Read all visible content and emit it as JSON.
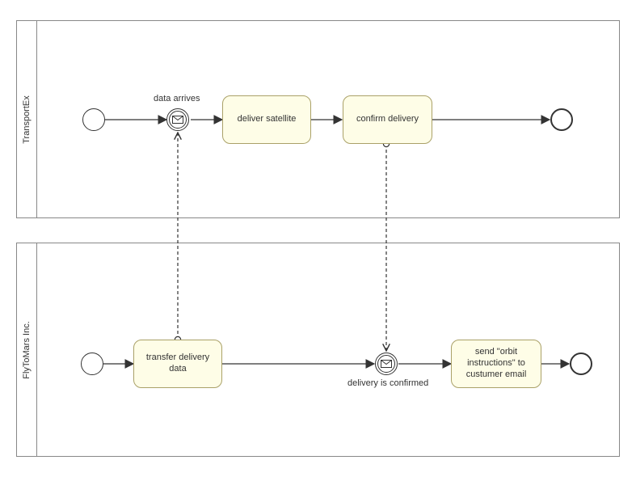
{
  "pools": {
    "top": {
      "name": "TransportEx"
    },
    "bottom": {
      "name": "FlyToMars Inc."
    }
  },
  "events": {
    "dataArrives": {
      "label": "data arrives"
    },
    "deliveryConfirmed": {
      "label": "delivery is confirmed"
    }
  },
  "tasks": {
    "deliverSatellite": "deliver satellite",
    "confirmDelivery": "confirm delivery",
    "transferDeliveryData": "transfer delivery data",
    "sendOrbitInstructions": "send \"orbit instructions\" to custumer email"
  }
}
